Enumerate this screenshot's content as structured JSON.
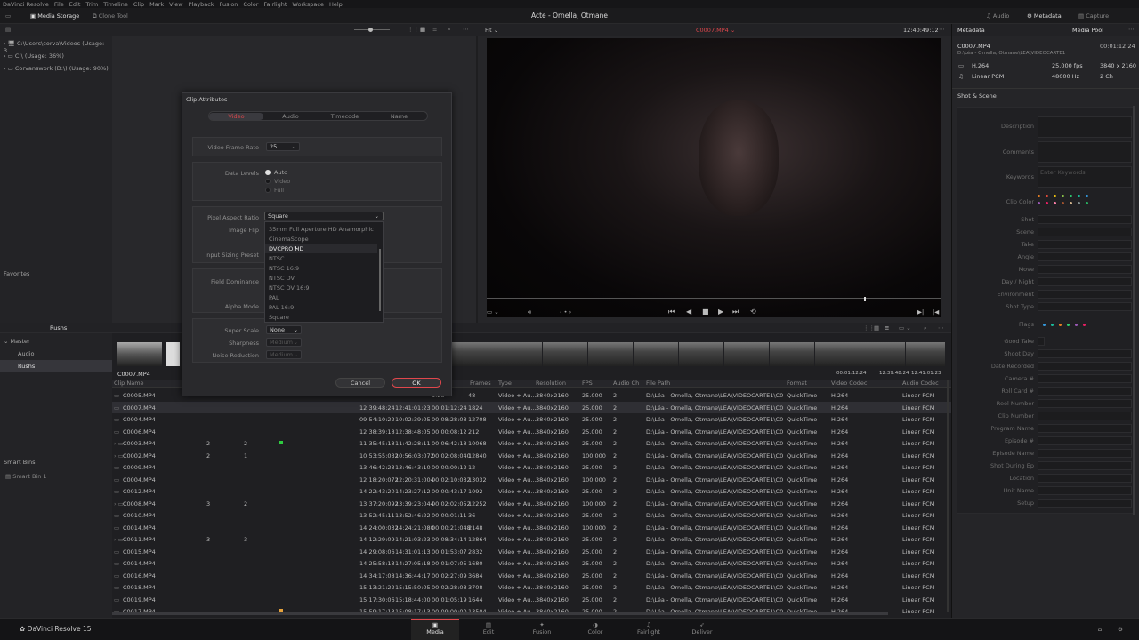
{
  "menubar": [
    "DaVinci Resolve",
    "File",
    "Edit",
    "Trim",
    "Timeline",
    "Clip",
    "Mark",
    "View",
    "Playback",
    "Fusion",
    "Color",
    "Fairlight",
    "Workspace",
    "Help"
  ],
  "topbar": {
    "media_storage": "Media Storage",
    "clone_tool": "Clone Tool",
    "title": "Acte - Ornella, Otmane",
    "audio": "Audio",
    "metadata": "Metadata",
    "capture": "Capture"
  },
  "viewer": {
    "fit": "Fit",
    "clip": "C0007.MP4",
    "timecode": "12:40:49:12"
  },
  "storage": {
    "items": [
      "C:\\Users\\corva\\Videos (Usage: 3...",
      "C:\\ (Usage: 36%)",
      "Corvanswork (D:\\) (Usage: 90%)"
    ],
    "favorites": "Favorites"
  },
  "pool": {
    "tree": [
      "Master",
      "Audio",
      "Rushs"
    ],
    "title": "Rushs",
    "smart_bins": "Smart Bins",
    "smart_bin_1": "Smart Bin 1",
    "thumb_label": "C0007.MP4",
    "tc1": "00:01:12:24",
    "tc2": "12:39:48:24",
    "tc3": "12:41:01:23"
  },
  "table": {
    "headers": [
      "Clip Name",
      "Frames",
      "Type",
      "Resolution",
      "FPS",
      "Audio Ch",
      "File Path",
      "Format",
      "Video Codec",
      "Audio Codec"
    ],
    "rows": [
      [
        "C0005.MP4",
        "",
        "",
        "",
        "",
        "",
        "1:23",
        "48",
        "Video + Au...",
        "3840x2160",
        "25.000",
        "2",
        "D:\\Léa - Ornella, Otmane\\LEA\\VIDEOCARTE1\\C000...",
        "QuickTime",
        "H.264",
        "Linear PCM"
      ],
      [
        "C0007.MP4",
        "",
        "",
        "",
        "12:39:48:24",
        "12:41:01:23",
        "00:01:12:24",
        "1824",
        "Video + Au...",
        "3840x2160",
        "25.000",
        "2",
        "D:\\Léa - Ornella, Otmane\\LEA\\VIDEOCARTE1\\C000...",
        "QuickTime",
        "H.264",
        "Linear PCM"
      ],
      [
        "C0004.MP4",
        "",
        "",
        "",
        "09:54:10:22",
        "10:02:39:05",
        "00:08:28:08",
        "12708",
        "Video + Au...",
        "3840x2160",
        "25.000",
        "2",
        "D:\\Léa - Ornella, Otmane\\LEA\\VIDEOCARTE1\\C000...",
        "QuickTime",
        "H.264",
        "Linear PCM"
      ],
      [
        "C0006.MP4",
        "",
        "",
        "",
        "12:38:39:18",
        "12:38:48:05",
        "00:00:08:12",
        "212",
        "Video + Au...",
        "3840x2160",
        "25.000",
        "2",
        "D:\\Léa - Ornella, Otmane\\LEA\\VIDEOCARTE1\\C000...",
        "QuickTime",
        "H.264",
        "Linear PCM"
      ],
      [
        "C0003.MP4",
        "2",
        "2",
        "g",
        "11:35:45:18",
        "11:42:28:11",
        "00:06:42:18",
        "10068",
        "Video + Au...",
        "3840x2160",
        "25.000",
        "2",
        "D:\\Léa - Ornella, Otmane\\LEA\\VIDEOCARTE1\\C000...",
        "QuickTime",
        "H.264",
        "Linear PCM"
      ],
      [
        "C0002.MP4",
        "2",
        "1",
        "",
        "10:53:55:032",
        "10:56:03:072",
        "00:02:08:040",
        "12840",
        "Video + Au...",
        "3840x2160",
        "100.000",
        "2",
        "D:\\Léa - Ornella, Otmane\\LEA\\VIDEOCARTE1\\C000...",
        "QuickTime",
        "H.264",
        "Linear PCM"
      ],
      [
        "C0009.MP4",
        "",
        "",
        "",
        "13:46:42:23",
        "13:46:43:10",
        "00:00:00:12",
        "12",
        "Video + Au...",
        "3840x2160",
        "25.000",
        "2",
        "D:\\Léa - Ornella, Otmane\\LEA\\VIDEOCARTE1\\C000...",
        "QuickTime",
        "H.264",
        "Linear PCM"
      ],
      [
        "C0004.MP4",
        "",
        "",
        "",
        "12:18:20:072",
        "12:20:31:004",
        "00:02:10:032",
        "13032",
        "Video + Au...",
        "3840x2160",
        "100.000",
        "2",
        "D:\\Léa - Ornella, Otmane\\LEA\\VIDEOCARTE1\\C000...",
        "QuickTime",
        "H.264",
        "Linear PCM"
      ],
      [
        "C0012.MP4",
        "",
        "",
        "",
        "14:22:43:20",
        "14:23:27:12",
        "00:00:43:17",
        "1092",
        "Video + Au...",
        "3840x2160",
        "25.000",
        "2",
        "D:\\Léa - Ornella, Otmane\\LEA\\VIDEOCARTE1\\C001...",
        "QuickTime",
        "H.264",
        "Linear PCM"
      ],
      [
        "C0008.MP4",
        "3",
        "2",
        "",
        "13:37:20:092",
        "13:39:23:044",
        "00:02:02:052",
        "12252",
        "Video + Au...",
        "3840x2160",
        "100.000",
        "2",
        "D:\\Léa - Ornella, Otmane\\LEA\\VIDEOCARTE1\\C000...",
        "QuickTime",
        "H.264",
        "Linear PCM"
      ],
      [
        "C0010.MP4",
        "",
        "",
        "",
        "13:52:45:11",
        "13:52:46:22",
        "00:00:01:11",
        "36",
        "Video + Au...",
        "3840x2160",
        "25.000",
        "2",
        "D:\\Léa - Ornella, Otmane\\LEA\\VIDEOCARTE1\\C001...",
        "QuickTime",
        "H.264",
        "Linear PCM"
      ],
      [
        "C0014.MP4",
        "",
        "",
        "",
        "14:24:00:032",
        "14:24:21:080",
        "00:00:21:048",
        "2148",
        "Video + Au...",
        "3840x2160",
        "100.000",
        "2",
        "D:\\Léa - Ornella, Otmane\\LEA\\VIDEOCARTE1\\C001...",
        "QuickTime",
        "H.264",
        "Linear PCM"
      ],
      [
        "C0011.MP4",
        "3",
        "3",
        "",
        "14:12:29:09",
        "14:21:03:23",
        "00:08:34:14",
        "12864",
        "Video + Au...",
        "3840x2160",
        "25.000",
        "2",
        "D:\\Léa - Ornella, Otmane\\LEA\\VIDEOCARTE1\\C001...",
        "QuickTime",
        "H.264",
        "Linear PCM"
      ],
      [
        "C0015.MP4",
        "",
        "",
        "",
        "14:29:08:06",
        "14:31:01:13",
        "00:01:53:07",
        "2832",
        "Video + Au...",
        "3840x2160",
        "25.000",
        "2",
        "D:\\Léa - Ornella, Otmane\\LEA\\VIDEOCARTE1\\C001...",
        "QuickTime",
        "H.264",
        "Linear PCM"
      ],
      [
        "C0014.MP4",
        "",
        "",
        "",
        "14:25:58:13",
        "14:27:05:18",
        "00:01:07:05",
        "1680",
        "Video + Au...",
        "3840x2160",
        "25.000",
        "2",
        "D:\\Léa - Ornella, Otmane\\LEA\\VIDEOCARTE1\\C001...",
        "QuickTime",
        "H.264",
        "Linear PCM"
      ],
      [
        "C0016.MP4",
        "",
        "",
        "",
        "14:34:17:08",
        "14:36:44:17",
        "00:02:27:09",
        "3684",
        "Video + Au...",
        "3840x2160",
        "25.000",
        "2",
        "D:\\Léa - Ornella, Otmane\\LEA\\VIDEOCARTE1\\C001...",
        "QuickTime",
        "H.264",
        "Linear PCM"
      ],
      [
        "C0018.MP4",
        "",
        "",
        "",
        "15:13:21:22",
        "15:15:50:05",
        "00:02:28:08",
        "3708",
        "Video + Au...",
        "3840x2160",
        "25.000",
        "2",
        "D:\\Léa - Ornella, Otmane\\LEA\\VIDEOCARTE1\\C001...",
        "QuickTime",
        "H.264",
        "Linear PCM"
      ],
      [
        "C0019.MP4",
        "",
        "",
        "",
        "15:17:30:06",
        "15:18:44:00",
        "00:01:05:19",
        "1644",
        "Video + Au...",
        "3840x2160",
        "25.000",
        "2",
        "D:\\Léa - Ornella, Otmane\\LEA\\VIDEOCARTE1\\C001...",
        "QuickTime",
        "H.264",
        "Linear PCM"
      ],
      [
        "C0017.MP4",
        "",
        "",
        "o",
        "15:59:17:13",
        "15:08:17:13",
        "00:09:00:00",
        "13504",
        "Video + Au...",
        "3840x2160",
        "25.000",
        "2",
        "D:\\Léa - Ornella, Otmane\\LEA\\VIDEOCARTE1\\C001...",
        "QuickTime",
        "H.264",
        "Linear PCM"
      ]
    ]
  },
  "dialog": {
    "title": "Clip Attributes",
    "tabs": [
      "Video",
      "Audio",
      "Timecode",
      "Name"
    ],
    "video_frame_rate_label": "Video Frame Rate",
    "video_frame_rate": "25",
    "data_levels_label": "Data Levels",
    "data_levels": [
      "Auto",
      "Video",
      "Full"
    ],
    "pixel_aspect_label": "Pixel Aspect Ratio",
    "pixel_aspect": "Square",
    "image_flip_label": "Image Flip",
    "input_sizing_label": "Input Sizing Preset",
    "field_dominance_label": "Field Dominance",
    "alpha_mode_label": "Alpha Mode",
    "super_scale_label": "Super Scale",
    "super_scale": "None",
    "sharpness_label": "Sharpness",
    "sharpness": "Medium",
    "noise_reduction_label": "Noise Reduction",
    "noise_reduction": "Medium",
    "cancel": "Cancel",
    "ok": "OK",
    "options": [
      "35mm Full Aperture HD Anamorphic",
      "CinemaScope",
      "DVCPRO HD",
      "NTSC",
      "NTSC 16:9",
      "NTSC DV",
      "NTSC DV 16:9",
      "PAL",
      "PAL 16:9",
      "Square"
    ]
  },
  "metadata": {
    "title": "Metadata",
    "pool": "Media Pool",
    "clip": "C0007.MP4",
    "duration": "00:01:12:24",
    "path": "D:\\Léa - Ornella, Otmane\\LEA\\VIDEOCARTE1",
    "codec": "H.264",
    "fps": "25.000 fps",
    "res": "3840 x 2160",
    "audio": "Linear PCM",
    "hz": "48000 Hz",
    "ch": "2 Ch",
    "section": "Shot & Scene",
    "fields": [
      "Description",
      "Comments",
      "Keywords",
      "Clip Color",
      "Shot",
      "Scene",
      "Take",
      "Angle",
      "Move",
      "Day / Night",
      "Environment",
      "Shot Type",
      "Flags",
      "Good Take",
      "Shoot Day",
      "Date Recorded",
      "Camera #",
      "Roll Card #",
      "Reel Number",
      "Clip Number",
      "Program Name",
      "Episode #",
      "Episode Name",
      "Shot During Ep",
      "Location",
      "Unit Name",
      "Setup"
    ],
    "keywords_placeholder": "Enter Keywords"
  },
  "bottom": {
    "app": "DaVinci Resolve 15",
    "pages": [
      "Media",
      "Edit",
      "Fusion",
      "Color",
      "Fairlight",
      "Deliver"
    ]
  },
  "colors": {
    "accent": "#e0474c",
    "selected": "#2f2f34"
  }
}
